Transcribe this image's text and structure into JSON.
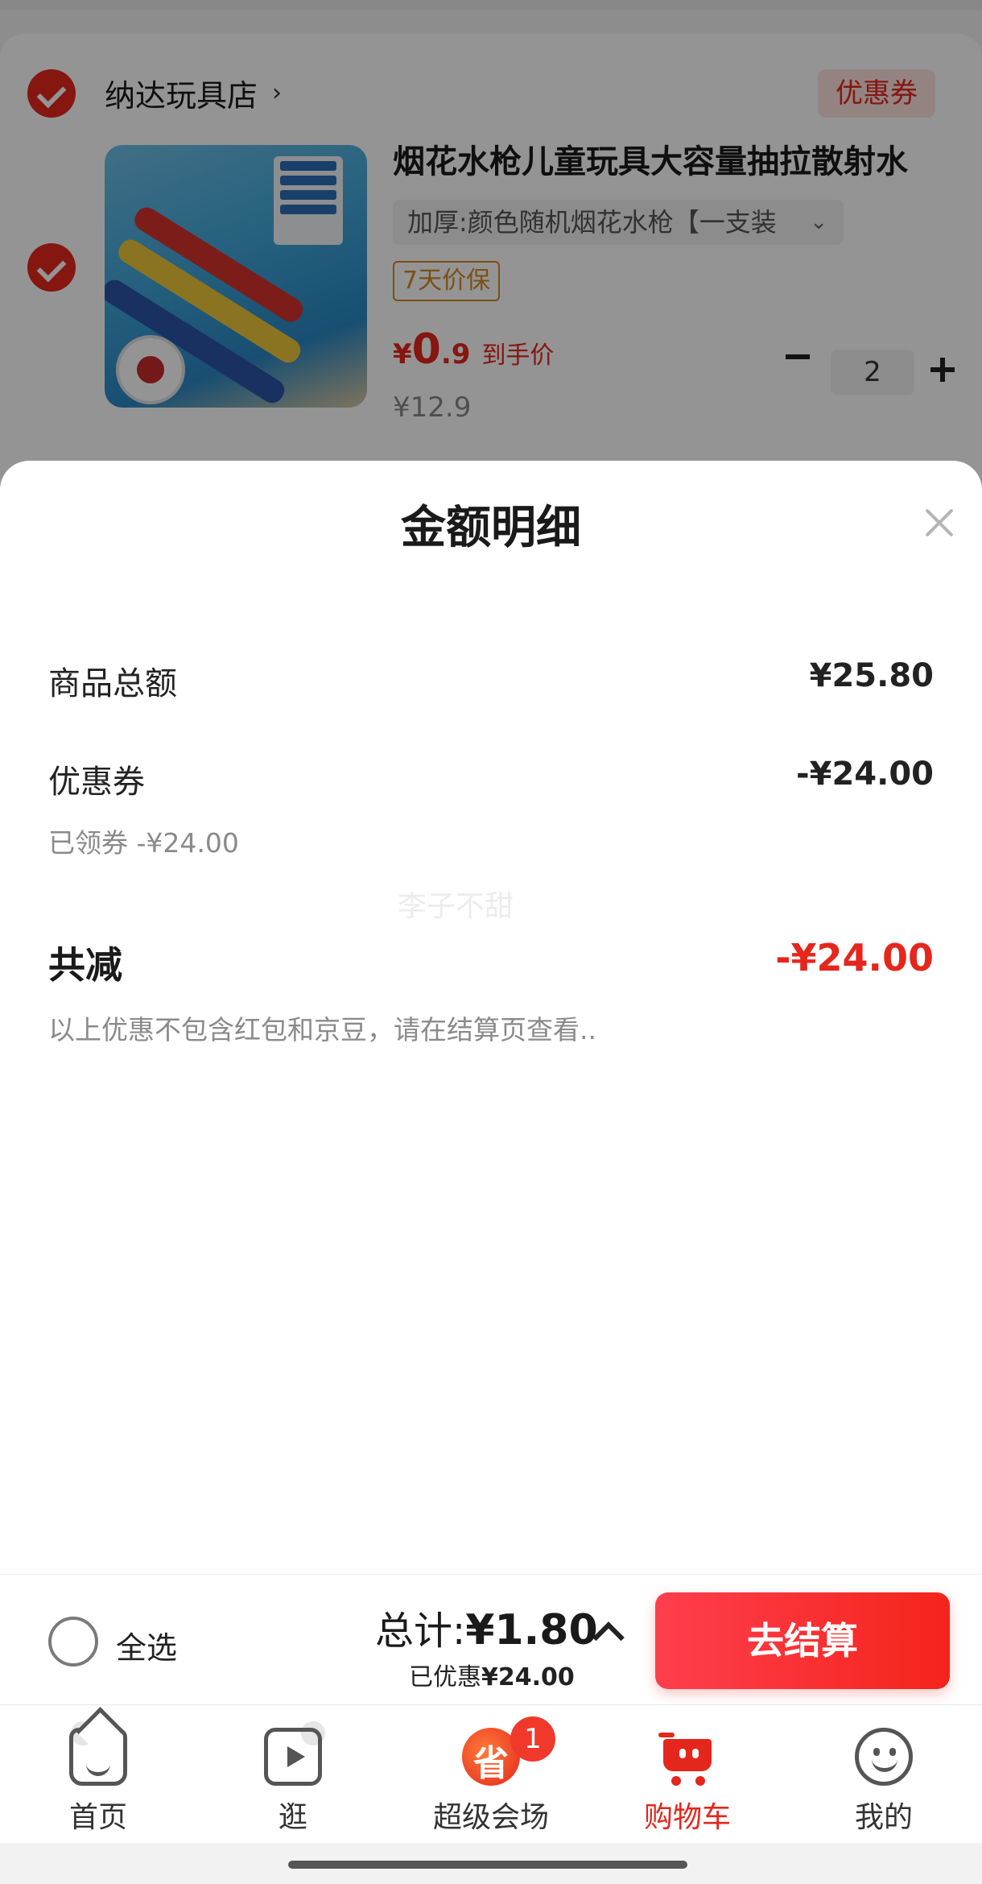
{
  "cart": {
    "shop_name": "纳达玩具店",
    "shop_chevron": "›",
    "coupon_tag": "优惠券",
    "product": {
      "title": "烟花水枪儿童玩具大容量抽拉散射水",
      "spec": "加厚:颜色随机烟花水枪【一支装",
      "spec_arrow": "⌄",
      "guarantee": "7天价保",
      "price_currency": "¥",
      "price_int": "0",
      "price_dec": ".9",
      "price_label": "到手价",
      "original_price": "¥12.9",
      "quantity": "2"
    }
  },
  "sheet": {
    "title": "金额明细",
    "rows": {
      "goods_total_label": "商品总额",
      "goods_total_value": "¥25.80",
      "coupon_label": "优惠券",
      "coupon_value": "-¥24.00",
      "coupon_sub": "已领券 -¥24.00",
      "total_off_label": "共减",
      "total_off_value": "-¥24.00",
      "note": "以上优惠不包含红包和京豆，请在结算页查看.."
    },
    "watermark": "李子不甜"
  },
  "checkout": {
    "select_all": "全选",
    "total_prefix": "总计:",
    "total_amount": "¥1.80",
    "saved_prefix": "已优惠",
    "saved_amount": "¥24.00",
    "button": "去结算"
  },
  "tabbar": {
    "home": "首页",
    "browse": "逛",
    "super": "超级会场",
    "super_icon_text": "省",
    "super_badge": "1",
    "cart": "购物车",
    "me": "我的"
  },
  "colors": {
    "accent": "#e5261c",
    "guarantee": "#d4891f"
  }
}
